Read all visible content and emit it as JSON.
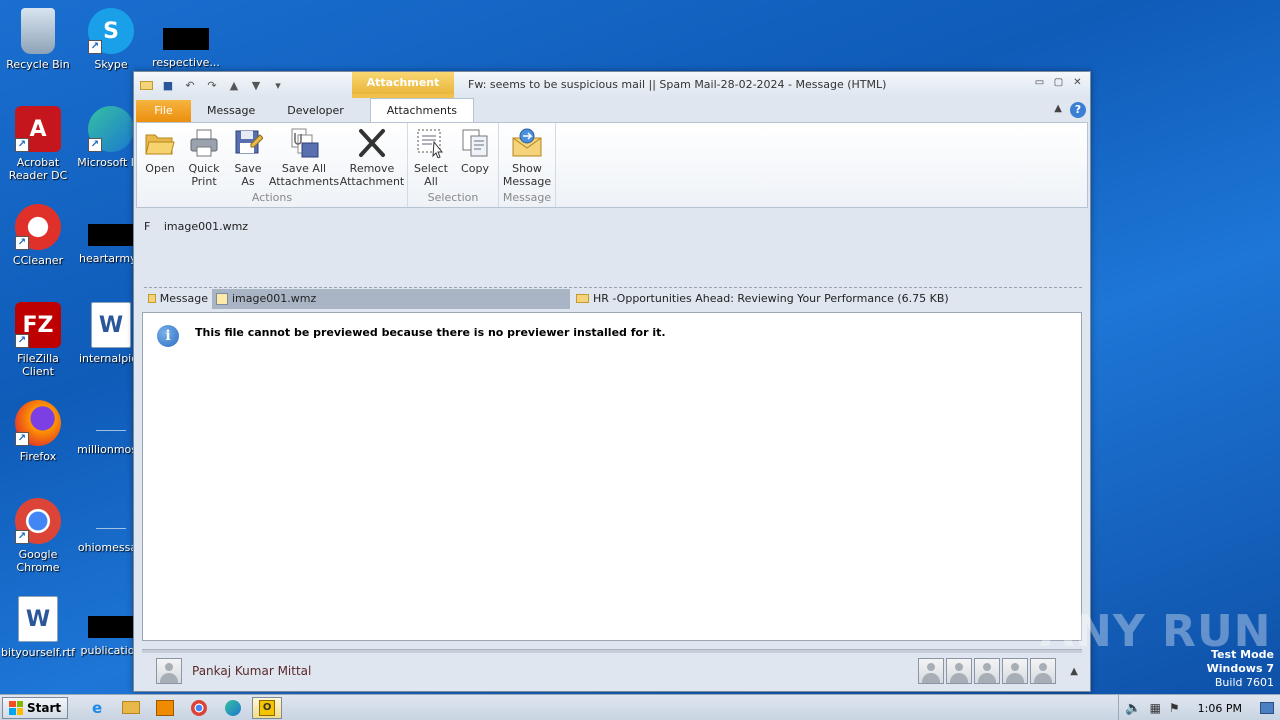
{
  "desktop": {
    "icons": [
      {
        "label": "Recycle Bin"
      },
      {
        "label": "Skype"
      },
      {
        "label": "respective..."
      },
      {
        "label": "Acrobat Reader DC"
      },
      {
        "label": "Microsoft Ed"
      },
      {
        "label": "CCleaner"
      },
      {
        "label": "heartarmy.r"
      },
      {
        "label": "FileZilla Client"
      },
      {
        "label": "internalpics"
      },
      {
        "label": "Firefox"
      },
      {
        "label": "millionmost."
      },
      {
        "label": "Google Chrome"
      },
      {
        "label": "ohiomessag"
      },
      {
        "label": "bityourself.rtf"
      },
      {
        "label": "publication"
      }
    ]
  },
  "window": {
    "context_tab": "Attachment Tools",
    "title": "Fw: seems to be suspicious mail || Spam Mail-28-02-2024 - Message (HTML)",
    "tabs": [
      "File",
      "Message",
      "Developer",
      "Attachments"
    ],
    "active_tab": "Attachments"
  },
  "ribbon": {
    "groups": [
      {
        "label": "Actions",
        "buttons": [
          {
            "line1": "Open",
            "line2": ""
          },
          {
            "line1": "Quick",
            "line2": "Print"
          },
          {
            "line1": "Save",
            "line2": "As"
          },
          {
            "line1": "Save All",
            "line2": "Attachments"
          },
          {
            "line1": "Remove",
            "line2": "Attachment"
          }
        ]
      },
      {
        "label": "Selection",
        "buttons": [
          {
            "line1": "Select",
            "line2": "All"
          },
          {
            "line1": "Copy",
            "line2": ""
          }
        ]
      },
      {
        "label": "Message",
        "buttons": [
          {
            "line1": "Show",
            "line2": "Message"
          }
        ]
      }
    ]
  },
  "attachment_header": {
    "prefix": "F",
    "filename": "image001.wmz"
  },
  "attachment_tabs": [
    {
      "label": "Message"
    },
    {
      "label": "image001.wmz"
    },
    {
      "label": "HR -Opportunities Ahead: Reviewing Your Performance (6.75 KB)"
    }
  ],
  "preview": {
    "message": "This file cannot be previewed because there is no previewer installed for it."
  },
  "people_pane": {
    "name": "Pankaj Kumar Mittal"
  },
  "watermark": "ANY RUN",
  "os": {
    "test_mode": "Test Mode",
    "version": "Windows 7",
    "build": "Build 7601"
  },
  "taskbar": {
    "start_label": "Start",
    "clock": "1:06 PM"
  }
}
